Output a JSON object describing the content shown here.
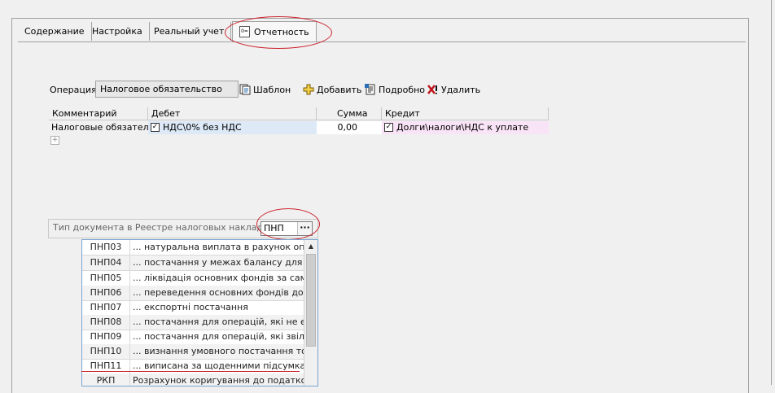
{
  "tabs": [
    {
      "label": "Содержание"
    },
    {
      "label": "Настройка"
    },
    {
      "label": "Реальный учет"
    },
    {
      "label": "Отчетность"
    }
  ],
  "operation": {
    "label": "Операция",
    "value": "Налоговое обязательство"
  },
  "toolbar": {
    "template_label": "Шаблон",
    "add_label": "Добавить",
    "details_label": "Подробно",
    "delete_label": "Удалить"
  },
  "grid": {
    "headers": [
      "Комментарий",
      "Дебет",
      "Сумма",
      "Кредит"
    ],
    "row": {
      "comment": "Налоговые обязатель",
      "debit": "НДС\\0% без НДС",
      "amount": "0,00",
      "credit": "Долги\\налоги\\НДС к уплате"
    }
  },
  "registry": {
    "label": "Тип документа в Реестре налоговых накладных",
    "value": "ПНП",
    "button": "···"
  },
  "list": [
    {
      "code": "ПНП03",
      "desc": "... натуральна виплата в рахунок оплат"
    },
    {
      "code": "ПНП04",
      "desc": "... постачання у межах балансу для не"
    },
    {
      "code": "ПНП05",
      "desc": "... ліквідація основних фондів за самос"
    },
    {
      "code": "ПНП06",
      "desc": "...  переведення  основних  фондів до ск"
    },
    {
      "code": "ПНП07",
      "desc": "... експортні постачання"
    },
    {
      "code": "ПНП08",
      "desc": "...  постачання  для  операцій, які не є об"
    },
    {
      "code": "ПНП09",
      "desc": "...  постачання  для  операцій, які звільне"
    },
    {
      "code": "ПНП10",
      "desc": "... визнання умовного постачання това"
    },
    {
      "code": "ПНП11",
      "desc": "...  виписана  за  щоденними  підсумками"
    },
    {
      "code": "РКП",
      "desc": "Розрахунок  коригування до податкової"
    }
  ],
  "colors": {
    "highlight_red": "#cc1f2a",
    "debit_bg": "#dde9f7",
    "credit_bg": "#f9e3f6",
    "list_border": "#7aa3d0"
  }
}
